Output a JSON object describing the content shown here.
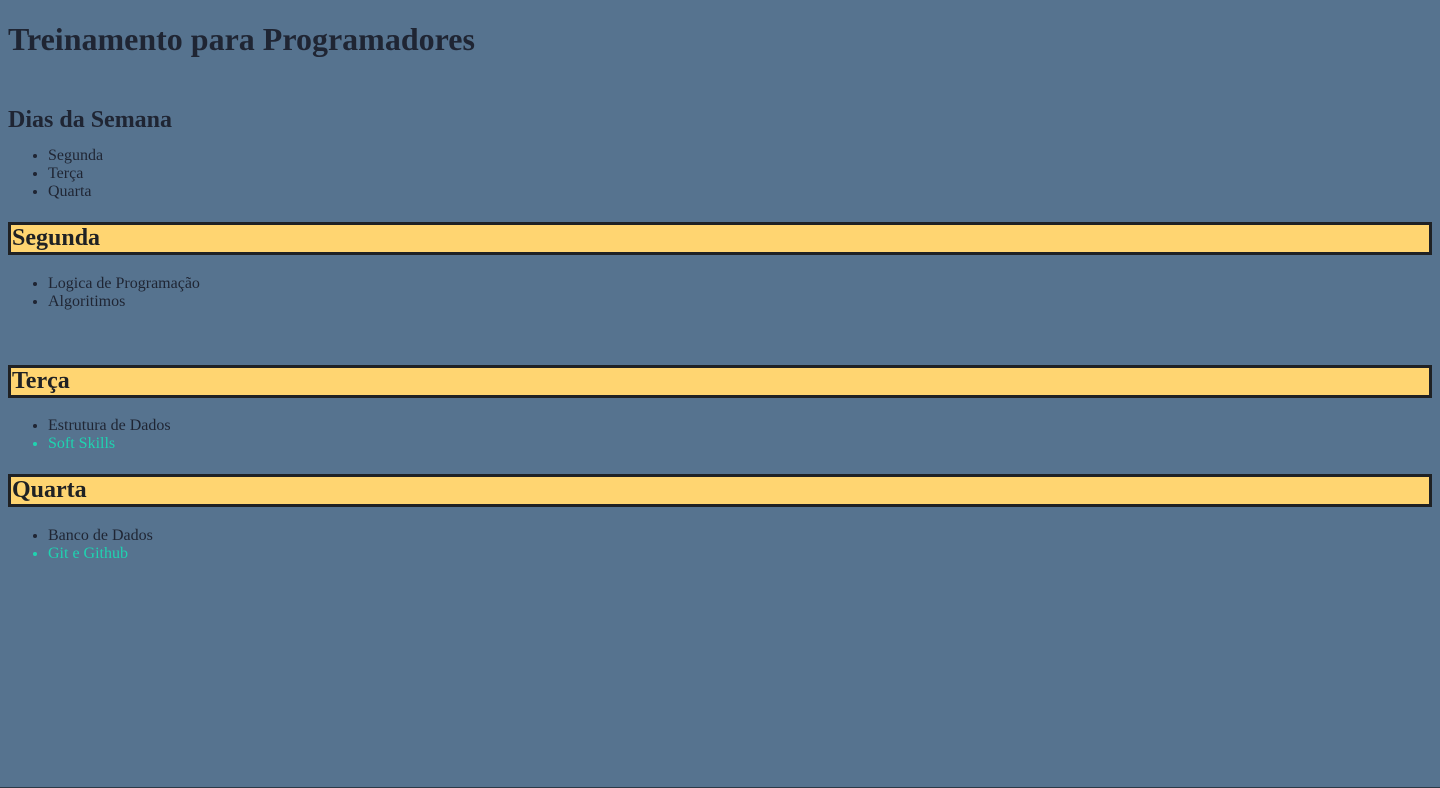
{
  "page": {
    "title": "Treinamento para Programadores",
    "week_heading": "Dias da Semana",
    "week_days": [
      "Segunda",
      "Terça",
      "Quarta"
    ]
  },
  "sections": {
    "segunda": {
      "title": "Segunda",
      "items": [
        "Logica de Programação",
        "Algoritimos"
      ]
    },
    "terca": {
      "title": "Terça",
      "items": [
        "Estrutura de Dados",
        "Soft Skills"
      ]
    },
    "quarta": {
      "title": "Quarta",
      "items": [
        "Banco de Dados",
        "Git e Github"
      ]
    }
  },
  "colors": {
    "background": "#56738f",
    "day_box": "#ffd571",
    "accent_item": "#1fd3b0",
    "text": "#1f2533"
  }
}
